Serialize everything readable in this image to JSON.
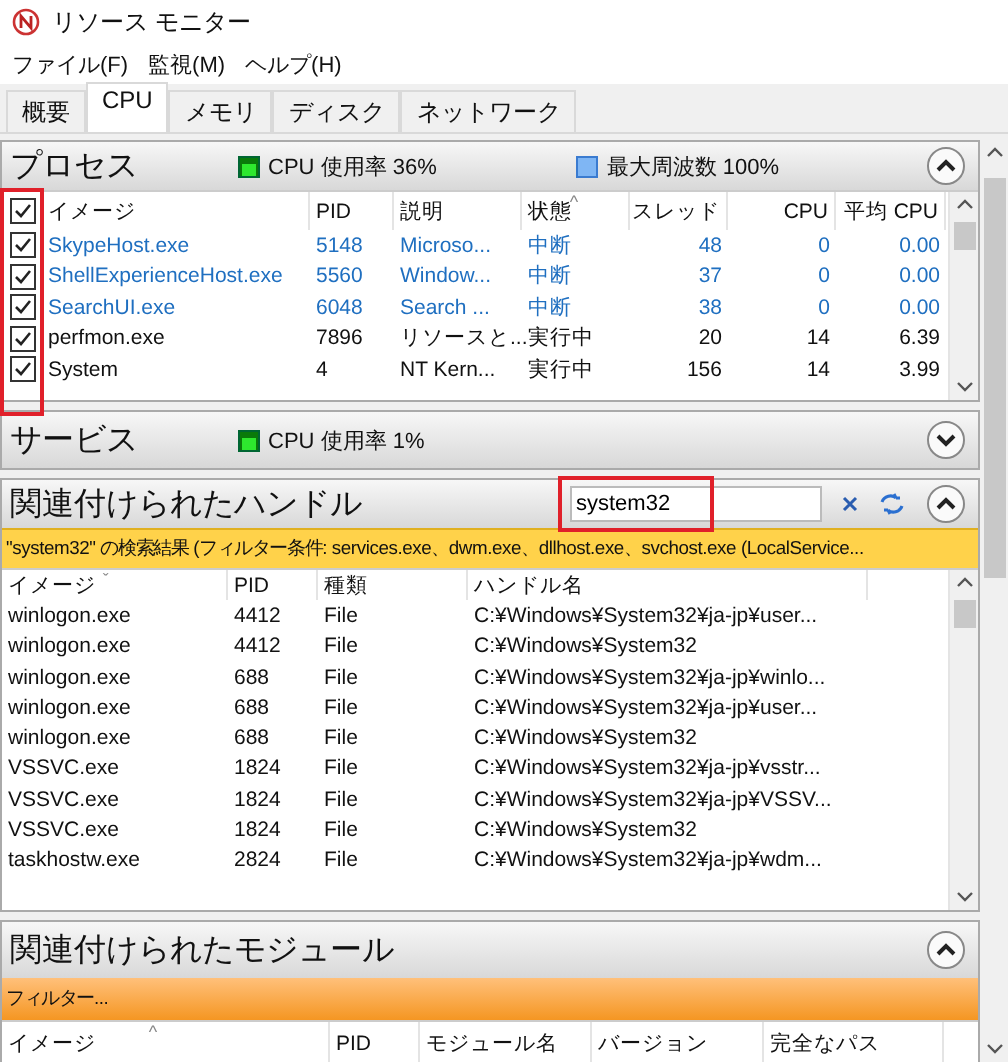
{
  "window": {
    "title": "リソース モニター"
  },
  "menu": [
    "ファイル(F)",
    "監視(M)",
    "ヘルプ(H)"
  ],
  "tabs": [
    {
      "label": "概要",
      "selected": false
    },
    {
      "label": "CPU",
      "selected": true
    },
    {
      "label": "メモリ",
      "selected": false
    },
    {
      "label": "ディスク",
      "selected": false
    },
    {
      "label": "ネットワーク",
      "selected": false
    }
  ],
  "processes": {
    "title": "プロセス",
    "expanded": true,
    "highlighted": true,
    "all_checked": true,
    "legends": [
      {
        "kind": "meter",
        "label": "CPU 使用率 36%"
      },
      {
        "kind": "swatch",
        "label": "最大周波数 100%"
      }
    ],
    "columns": [
      {
        "label": "イメージ"
      },
      {
        "label": "PID"
      },
      {
        "label": "説明"
      },
      {
        "label": "状態",
        "sort": "^"
      },
      {
        "label": "スレッド"
      },
      {
        "label": "CPU"
      },
      {
        "label": "平均 CPU"
      }
    ],
    "rows": [
      {
        "checked": true,
        "suspended": true,
        "cells": [
          "SkypeHost.exe",
          "5148",
          "Microso...",
          "中断",
          "48",
          "0",
          "0.00"
        ]
      },
      {
        "checked": true,
        "suspended": true,
        "cells": [
          "ShellExperienceHost.exe",
          "5560",
          "Window...",
          "中断",
          "37",
          "0",
          "0.00"
        ]
      },
      {
        "checked": true,
        "suspended": true,
        "cells": [
          "SearchUI.exe",
          "6048",
          "Search ...",
          "中断",
          "38",
          "0",
          "0.00"
        ]
      },
      {
        "checked": true,
        "suspended": false,
        "cells": [
          "perfmon.exe",
          "7896",
          "リソースと...",
          "実行中",
          "20",
          "14",
          "6.39"
        ]
      },
      {
        "checked": true,
        "suspended": false,
        "cells": [
          "System",
          "4",
          "NT Kern...",
          "実行中",
          "156",
          "14",
          "3.99"
        ]
      }
    ]
  },
  "services": {
    "title": "サービス",
    "expanded": false,
    "legends": [
      {
        "kind": "meter",
        "label": "CPU 使用率 1%"
      }
    ]
  },
  "handles": {
    "title": "関連付けられたハンドル",
    "expanded": true,
    "search": {
      "value": "system32",
      "highlighted": true
    },
    "filter": "\"system32\" の検索結果 (フィルター条件: services.exe、dwm.exe、dllhost.exe、svchost.exe (LocalService...",
    "columns": [
      {
        "label": "イメージ",
        "sort": "ˇ"
      },
      {
        "label": "PID"
      },
      {
        "label": "種類"
      },
      {
        "label": "ハンドル名"
      }
    ],
    "rows": [
      [
        "winlogon.exe",
        "4412",
        "File",
        "C:¥Windows¥System32¥ja-jp¥user..."
      ],
      [
        "winlogon.exe",
        "4412",
        "File",
        "C:¥Windows¥System32"
      ],
      [
        "winlogon.exe",
        "688",
        "File",
        "C:¥Windows¥System32¥ja-jp¥winlo..."
      ],
      [
        "winlogon.exe",
        "688",
        "File",
        "C:¥Windows¥System32¥ja-jp¥user..."
      ],
      [
        "winlogon.exe",
        "688",
        "File",
        "C:¥Windows¥System32"
      ],
      [
        "VSSVC.exe",
        "1824",
        "File",
        "C:¥Windows¥System32¥ja-jp¥vsstr..."
      ],
      [
        "VSSVC.exe",
        "1824",
        "File",
        "C:¥Windows¥System32¥ja-jp¥VSSV..."
      ],
      [
        "VSSVC.exe",
        "1824",
        "File",
        "C:¥Windows¥System32"
      ],
      [
        "taskhostw.exe",
        "2824",
        "File",
        "C:¥Windows¥System32¥ja-jp¥wdm..."
      ]
    ]
  },
  "modules": {
    "title": "関連付けられたモジュール",
    "expanded": true,
    "filter": "フィルター...",
    "columns": [
      {
        "label": "イメージ",
        "sort": "^"
      },
      {
        "label": "PID"
      },
      {
        "label": "モジュール名"
      },
      {
        "label": "バージョン"
      },
      {
        "label": "完全なパス"
      }
    ]
  }
}
